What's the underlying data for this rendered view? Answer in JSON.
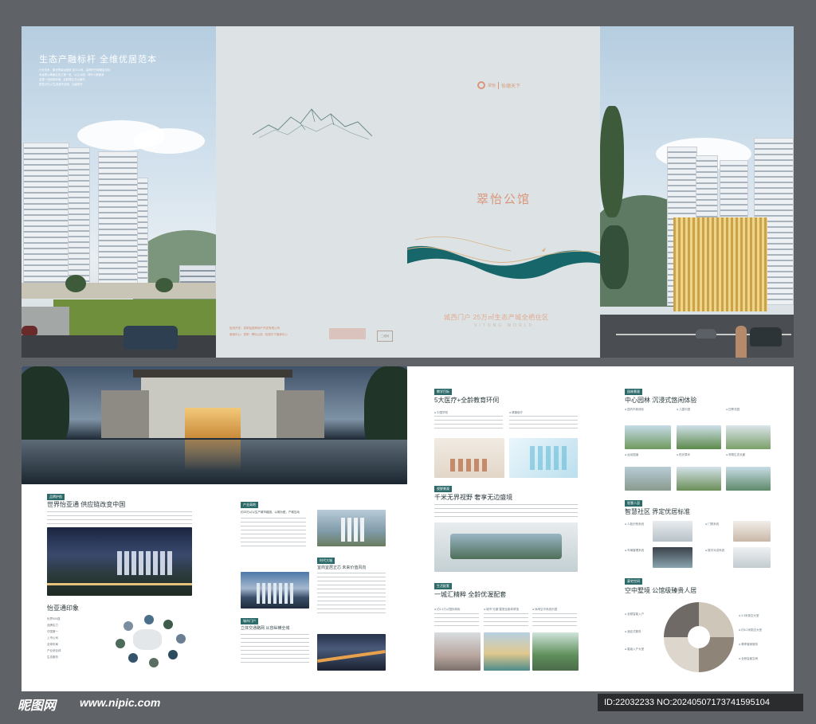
{
  "panel_left": {
    "title": "生态产融标杆 全维优居范本",
    "body_lines": [
      "行业未来，集世界级运营铁·岩义义地，赢得时代奔跑量目标",
      "永远是以奉献生态之家一处，以认为园，呼吁人新美净",
      "这里一站网络作用，这精神正式大都市",
      "匠筑25万㎡生态城市全城，礼献首开"
    ]
  },
  "panel_cover": {
    "logo_left": "翠怡",
    "logo_right": "怡德天下",
    "project_name": "翠怡公馆",
    "slogan": "城西门户 25万㎡生态产城全栖住区",
    "slogan_en": "VITONG WORLD",
    "footer_line1": "投资开发：昆明怡德房地产开发有限公司",
    "footer_line2": "营销中心：昆明 · 翠怡公馆 · 怡德天下营销中心",
    "qr_label": "二维码"
  },
  "sec_brand": {
    "tag": "品牌护航",
    "title": "世界怡亚通 供应链改变中国",
    "subtitle": "怡亚通印象",
    "facts": [
      "世界500强",
      "品牌实力",
      "中国第一",
      "上市公司",
      "全球布局",
      "产业综合体",
      "生态服务"
    ]
  },
  "sec_industry": {
    "tag1": "产业高地",
    "text1": "约25万㎡以生产城市组团，以城为纽，产城互动",
    "tag2": "时代大城",
    "title2": "宜商宜居正芯 未来价值风向",
    "tag3": "城市门户",
    "title3": "立体交通路网 从容纵横全城"
  },
  "sec_edu": {
    "tag": "教学目标",
    "title": "5大医疗+全龄教育环伺",
    "label1": "● 中国学校",
    "label2": "● 健康医疗"
  },
  "sec_view": {
    "tag": "视野景观",
    "title": "千米无界视野 奢享无边盛境"
  },
  "sec_life": {
    "tag": "生活配套",
    "title": "一城汇精粹 全龄优渥配套",
    "items": [
      "● 约1.4万㎡国际商街",
      "● 城市“光廊”嘉型全能体育馆",
      "● 休闲空中系统乐园"
    ]
  },
  "sec_garden": {
    "tag": "园林景观",
    "title": "中心园林 沉浸式悠闲体验",
    "items": [
      "● 园内市政绿化",
      "● 儿童乐园",
      "● 四季花园",
      "● 运动园道",
      "● 阳光草坪",
      "● 林荫生态长廊",
      "● 水景庭院",
      "● 亲子乐园",
      "● 休闲长廊"
    ]
  },
  "sec_smart": {
    "tag": "智慧人居",
    "title": "智慧社区 界定优居标准",
    "items": [
      "● 人脸识别系统",
      "● 门禁系统",
      "● 车辆管理系统",
      "● 楼宇对讲系统"
    ]
  },
  "sec_lobby": {
    "tag": "豪宅空间",
    "title": "空中墅境 公馆级臻贵人居",
    "items": [
      "● 全程智能入户",
      "● 3.3米架空大堂",
      "● 约5.2米挑空大堂",
      "● 酒店式服务",
      "● 尊享管家服务",
      "● 全龄会客空间",
      "● 星级入户大堂"
    ]
  },
  "watermark": {
    "site_cn": "昵图网",
    "site_url": "www.nipic.com",
    "image_id": "ID:22032233 NO:20240507173741595104"
  },
  "colors": {
    "accent_teal": "#2d6a6a",
    "brand_orange": "#d9967a",
    "frame": "#5f6266"
  }
}
